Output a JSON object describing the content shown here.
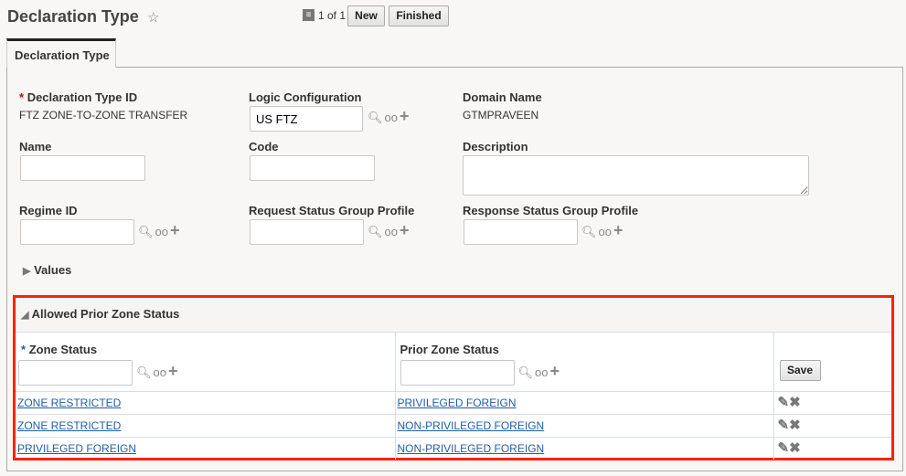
{
  "header": {
    "title": "Declaration Type",
    "pager": "1 of 1",
    "new_label": "New",
    "finished_label": "Finished"
  },
  "tab": {
    "label": "Declaration Type"
  },
  "form": {
    "decl_id": {
      "label": "Declaration Type ID",
      "value": "FTZ ZONE-TO-ZONE TRANSFER"
    },
    "logic_config": {
      "label": "Logic Configuration",
      "value": "US FTZ"
    },
    "domain": {
      "label": "Domain Name",
      "value": "GTMPRAVEEN"
    },
    "name": {
      "label": "Name",
      "value": ""
    },
    "code": {
      "label": "Code",
      "value": ""
    },
    "description": {
      "label": "Description",
      "value": ""
    },
    "regime": {
      "label": "Regime ID",
      "value": ""
    },
    "req_status": {
      "label": "Request Status Group Profile",
      "value": ""
    },
    "resp_status": {
      "label": "Response Status Group Profile",
      "value": ""
    }
  },
  "values_section": {
    "label": "Values"
  },
  "allowed": {
    "label": "Allowed Prior Zone Status",
    "col1": "Zone Status",
    "col2": "Prior Zone Status",
    "save_label": "Save",
    "rows": [
      {
        "zone": "ZONE RESTRICTED",
        "prior": "PRIVILEGED FOREIGN"
      },
      {
        "zone": "ZONE RESTRICTED",
        "prior": "NON-PRIVILEGED FOREIGN"
      },
      {
        "zone": "PRIVILEGED FOREIGN",
        "prior": "NON-PRIVILEGED FOREIGN"
      }
    ]
  },
  "colors": {
    "highlight": "#ff2200",
    "link": "#1f5fa6"
  }
}
